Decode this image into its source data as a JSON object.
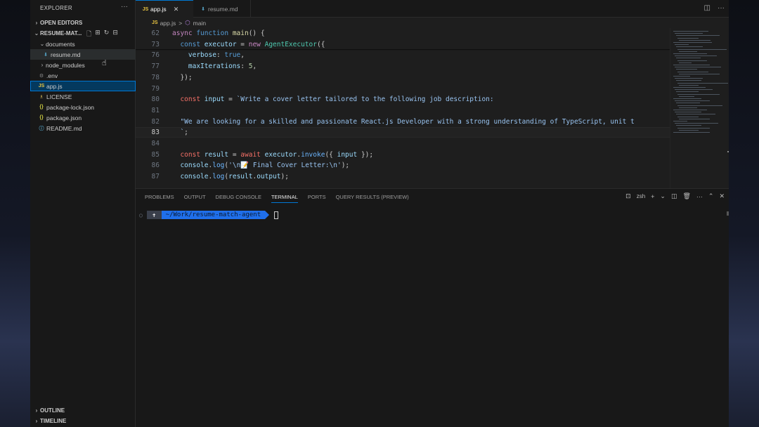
{
  "sidebar": {
    "title": "EXPLORER",
    "more": "···",
    "open_editors": "OPEN EDITORS",
    "project": "RESUME-MAT...",
    "items": [
      {
        "label": "documents",
        "icon": "chevron-down-icon"
      },
      {
        "label": "resume.md",
        "icon": "markdown-file-icon"
      },
      {
        "label": "node_modules",
        "icon": "chevron-right-icon"
      },
      {
        "label": ".env",
        "icon": "gear-icon"
      },
      {
        "label": "app.js",
        "icon": "js-file-icon"
      },
      {
        "label": "LICENSE",
        "icon": "license-icon"
      },
      {
        "label": "package-lock.json",
        "icon": "json-file-icon"
      },
      {
        "label": "package.json",
        "icon": "json-file-icon"
      },
      {
        "label": "README.md",
        "icon": "info-icon"
      }
    ],
    "outline": "OUTLINE",
    "timeline": "TIMELINE"
  },
  "tabs": [
    {
      "label": "app.js",
      "icon": "JS",
      "active": true
    },
    {
      "label": "resume.md",
      "icon": "md",
      "active": false
    }
  ],
  "breadcrumb": {
    "file": "app.js",
    "sep": ">",
    "symbol": "main"
  },
  "editor": {
    "current_line": "83",
    "lines": [
      {
        "n": "62",
        "tokens": [
          [
            "kw2",
            "async "
          ],
          [
            "kw",
            "function "
          ],
          [
            "fn",
            "main"
          ],
          [
            "",
            "() {"
          ]
        ]
      },
      {
        "n": "73",
        "tokens": [
          [
            "",
            "  "
          ],
          [
            "kw",
            "const "
          ],
          [
            "var",
            "executor"
          ],
          [
            "",
            " = "
          ],
          [
            "kw2",
            "new "
          ],
          [
            "cls",
            "AgentExecutor"
          ],
          [
            "",
            "({"
          ]
        ]
      },
      {
        "n": "76",
        "tokens": [
          [
            "",
            "    "
          ],
          [
            "var",
            "verbose"
          ],
          [
            "",
            ": "
          ],
          [
            "kw",
            "true"
          ],
          [
            "",
            ","
          ]
        ]
      },
      {
        "n": "77",
        "tokens": [
          [
            "",
            "    "
          ],
          [
            "var",
            "maxIterations"
          ],
          [
            "",
            ": "
          ],
          [
            "num",
            "5"
          ],
          [
            "",
            ","
          ]
        ]
      },
      {
        "n": "78",
        "tokens": [
          [
            "",
            "  });"
          ]
        ]
      },
      {
        "n": "79",
        "tokens": []
      },
      {
        "n": "80",
        "tokens": [
          [
            "",
            "  "
          ],
          [
            "red",
            "const "
          ],
          [
            "var",
            "input"
          ],
          [
            "",
            " = "
          ],
          [
            "strb",
            "`Write a cover letter tailored to the following job description:"
          ]
        ]
      },
      {
        "n": "81",
        "tokens": []
      },
      {
        "n": "82",
        "tokens": [
          [
            "strb",
            "  \"We are looking for a skilled and passionate React.js Developer with a strong understanding of TypeScript, unit t"
          ]
        ]
      },
      {
        "n": "83",
        "tokens": [
          [
            "strb",
            "  `"
          ],
          [
            "",
            ";"
          ]
        ]
      },
      {
        "n": "84",
        "tokens": []
      },
      {
        "n": "85",
        "tokens": [
          [
            "",
            "  "
          ],
          [
            "red",
            "const "
          ],
          [
            "var",
            "result"
          ],
          [
            "",
            " = "
          ],
          [
            "red",
            "await "
          ],
          [
            "var",
            "executor"
          ],
          [
            "",
            "."
          ],
          [
            "blue",
            "invoke"
          ],
          [
            "",
            "({ "
          ],
          [
            "var",
            "input"
          ],
          [
            "",
            " });"
          ]
        ]
      },
      {
        "n": "86",
        "tokens": [
          [
            "",
            "  "
          ],
          [
            "var",
            "console"
          ],
          [
            "",
            "."
          ],
          [
            "blue",
            "log"
          ],
          [
            "",
            "("
          ],
          [
            "strb",
            "'\\n📝 Final Cover Letter:\\n'"
          ],
          [
            "",
            ");"
          ]
        ]
      },
      {
        "n": "87",
        "tokens": [
          [
            "",
            "  "
          ],
          [
            "var",
            "console"
          ],
          [
            "",
            "."
          ],
          [
            "blue",
            "log"
          ],
          [
            "",
            "("
          ],
          [
            "var",
            "result"
          ],
          [
            "",
            "."
          ],
          [
            "var",
            "output"
          ],
          [
            "",
            ");"
          ]
        ]
      }
    ]
  },
  "panel": {
    "tabs": [
      "PROBLEMS",
      "OUTPUT",
      "DEBUG CONSOLE",
      "TERMINAL",
      "PORTS",
      "QUERY RESULTS (PREVIEW)"
    ],
    "active_tab": "TERMINAL",
    "shell": "zsh",
    "prompt_home": "✝",
    "prompt_path": "~/Work/resume-match-agent"
  }
}
